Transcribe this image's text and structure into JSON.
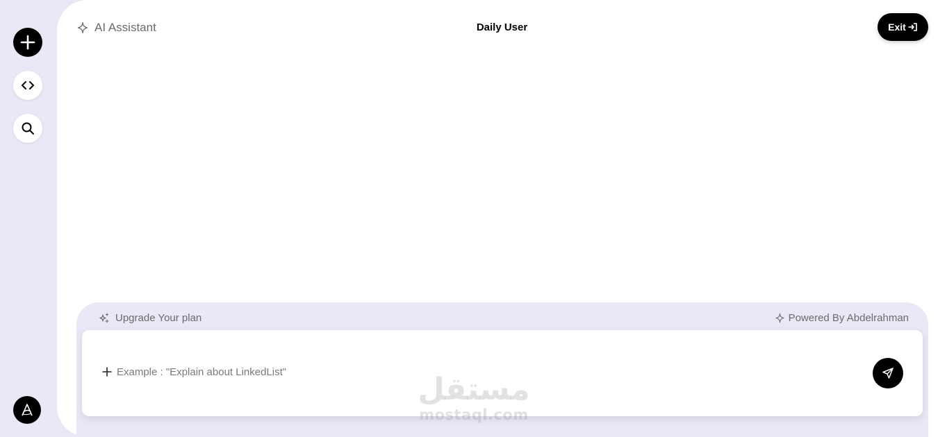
{
  "sidebar": {
    "items": [
      {
        "name": "new-chat",
        "icon": "plus-icon"
      },
      {
        "name": "code",
        "icon": "code-icon"
      },
      {
        "name": "search",
        "icon": "search-icon"
      }
    ],
    "logo_icon": "letter-a-logo-icon"
  },
  "header": {
    "assistant_label": "AI Assistant",
    "assistant_icon": "sparkle-icon",
    "user_label": "Daily User",
    "exit_label": "Exit",
    "exit_icon": "sign-in-icon"
  },
  "composer": {
    "upgrade_label": "Upgrade Your plan",
    "upgrade_icon": "sparkles-icon",
    "powered_label": "Powered By Abdelrahman",
    "powered_icon": "sparkle-icon",
    "input_placeholder": "Example : \"Explain about LinkedList\"",
    "input_value": "",
    "attach_icon": "plus-icon",
    "send_icon": "send-icon"
  },
  "watermark": {
    "arabic": "مستقل",
    "latin": "mostaql.com"
  },
  "colors": {
    "background": "#e8e8f6",
    "panel": "#ffffff",
    "accent": "#000000",
    "muted_text": "#6b6b6b"
  }
}
